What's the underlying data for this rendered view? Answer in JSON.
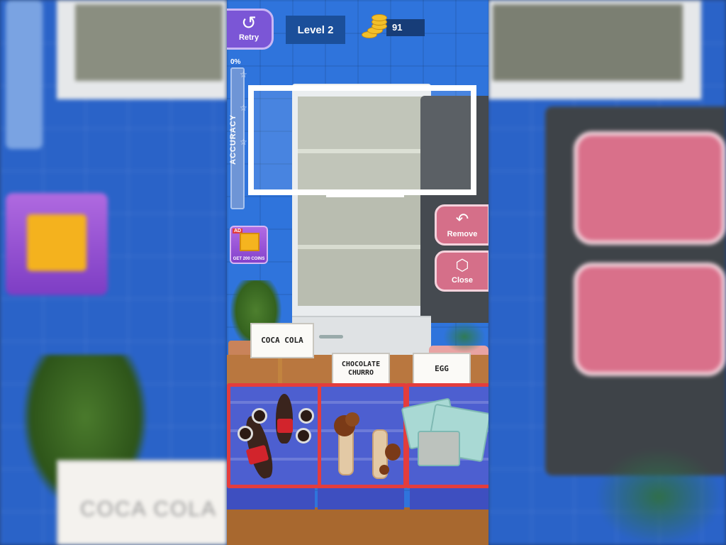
{
  "hud": {
    "retry_label": "Retry",
    "level_label": "Level 2",
    "coins": "91"
  },
  "accuracy": {
    "percent_label": "0%",
    "label": "ACCURACY",
    "value": 0
  },
  "gift_ad": {
    "badge": "AD",
    "label": "GET 200 COINS"
  },
  "actions": {
    "remove_label": "Remove",
    "close_label": "Close"
  },
  "tags": {
    "coca_cola": "COCA COLA",
    "churro_line1": "CHOCOLATE",
    "churro_line2": "CHURRO",
    "egg": "EGG"
  },
  "background_blur_text": "COCA COLA",
  "colors": {
    "wall_blue": "#2f74dc",
    "retry_purple": "#7b56d6",
    "action_pink": "#d56f89",
    "basket_red": "#e33d3d",
    "basket_blue": "#4d5fd0",
    "coin_gold": "#f2bf2a"
  },
  "icons": {
    "retry": "retry-arrow-icon",
    "coin": "coin-stack-icon",
    "remove": "undo-arrow-icon",
    "close": "box-icon",
    "gift": "gift-icon",
    "star": "star-icon"
  }
}
